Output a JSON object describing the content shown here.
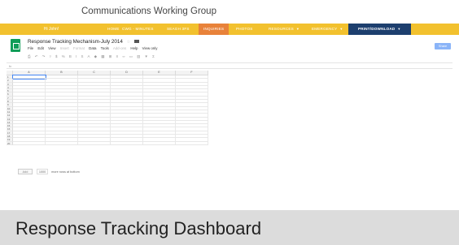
{
  "site": {
    "title": "Communications Working Group"
  },
  "nav": {
    "greeting": "Hi John!",
    "items": [
      {
        "label": "HOME"
      },
      {
        "label": "CWG - MINUTES"
      },
      {
        "label": "SEAGH 3FS"
      },
      {
        "label": "INQUIRIES"
      },
      {
        "label": "PHOTOS"
      },
      {
        "label": "RESOURCES"
      },
      {
        "label": "EMERGENCY"
      },
      {
        "label": "PRINT/DOWNLOAD"
      }
    ],
    "active_index": 3,
    "colors": {
      "bar": "#f2c12e",
      "active": "#e8823a",
      "print": "#1d3f6e"
    }
  },
  "sheet": {
    "title": "Response Tracking Mechanism-July 2014",
    "menu": [
      "File",
      "Edit",
      "View",
      "Insert",
      "Format",
      "Data",
      "Tools",
      "Add-ons",
      "Help",
      "View only"
    ],
    "share_label": "Share",
    "fx_label": "fx",
    "columns": [
      "A",
      "B",
      "C",
      "D",
      "E",
      "F"
    ],
    "rows": [
      "1",
      "2",
      "3",
      "4",
      "5",
      "6",
      "7",
      "8",
      "9",
      "10",
      "11",
      "12",
      "13",
      "14",
      "15",
      "16",
      "17",
      "18",
      "19",
      "20"
    ],
    "add_button": "Add",
    "add_count": "1000",
    "add_suffix": "more rows at bottom"
  },
  "caption": "Response Tracking Dashboard"
}
